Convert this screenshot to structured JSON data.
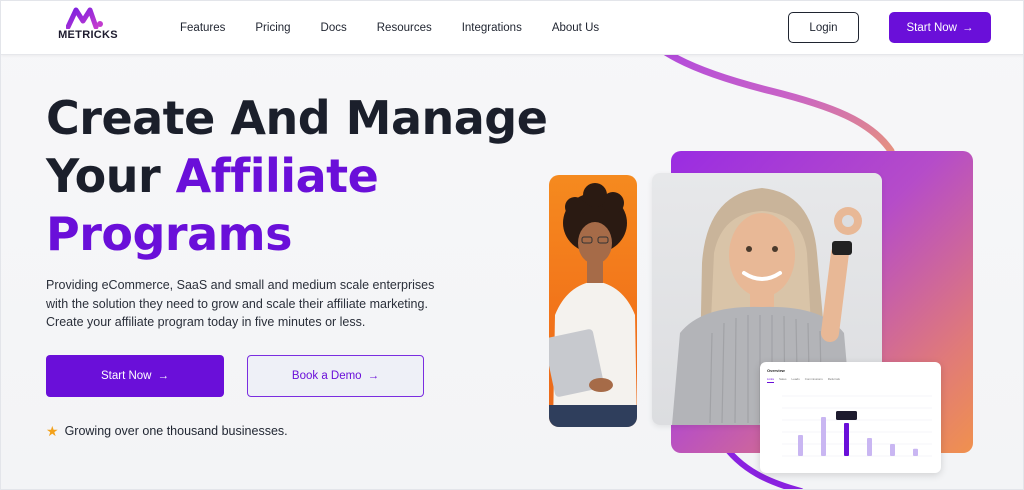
{
  "brand": {
    "name": "METRICKS",
    "accent": "#6a0fd9"
  },
  "nav": {
    "items": [
      "Features",
      "Pricing",
      "Docs",
      "Resources",
      "Integrations",
      "About Us"
    ],
    "login_label": "Login",
    "start_label": "Start Now"
  },
  "hero": {
    "title_line1": "Create And Manage",
    "title_line2_plain": "Your ",
    "title_line2_accent": "Affiliate",
    "title_line3_accent": "Programs",
    "description": "Providing eCommerce, SaaS and small and medium scale enterprises with the solution they need to grow and scale their affiliate marketing. Create your affiliate program today in five minutes or less.",
    "cta_primary": "Start Now",
    "cta_secondary": "Book a Demo",
    "social_proof": "Growing over one thousand businesses."
  },
  "dashboard": {
    "title": "Overview",
    "tabs": [
      "Links",
      "Sales",
      "Leads",
      "Commissions",
      "Referrals"
    ],
    "bars": [
      0.35,
      0.65,
      0.55,
      0.3,
      0.2,
      0.12
    ],
    "highlight_bar_value": 0.55,
    "highlight_index": 2
  },
  "colors": {
    "primary": "#6a0fd9",
    "orange": "#f2741a",
    "star": "#f3a11b"
  },
  "icons": [
    "arrow-right-icon",
    "star-icon"
  ]
}
